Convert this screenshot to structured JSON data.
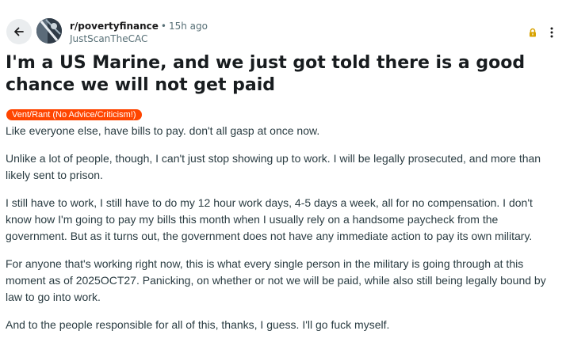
{
  "post": {
    "subreddit": "r/povertyfinance",
    "separator": "•",
    "time_ago": "15h ago",
    "username": "JustScanTheCAC",
    "title": "I'm a US Marine, and we just got told there is a good chance we will not get paid",
    "flair": "Vent/Rant (No Advice/Criticism!)",
    "paragraphs": [
      "Like everyone else, have bills to pay. don't all gasp at once now.",
      "Unlike a lot of people, though, I can't just stop showing up to work. I will be legally prosecuted, and more than likely sent to prison.",
      "I still have to work, I still have to do my 12 hour work days, 4-5 days a week, all for no compensation. I don't know how I'm going to pay my bills this month when I usually rely on a handsome paycheck from the government. But as it turns out, the government does not have any immediate action to pay its own military.",
      "For anyone that's working right now, this is what every single person in the military is going through at this moment as of 2025OCT27. Panicking, on whether or not we will be paid, while also still being legally bound by law to go into work.",
      "And to the people responsible for all of this, thanks, I guess. I'll go fuck myself."
    ]
  },
  "icons": {
    "back": "arrow-left-icon",
    "avatar": "avatar",
    "lock": "lock-icon",
    "more": "more-vertical-icon"
  },
  "colors": {
    "flair_bg": "#ff4500",
    "lock": "#d8a200",
    "back_btn_bg": "#eaedef"
  }
}
